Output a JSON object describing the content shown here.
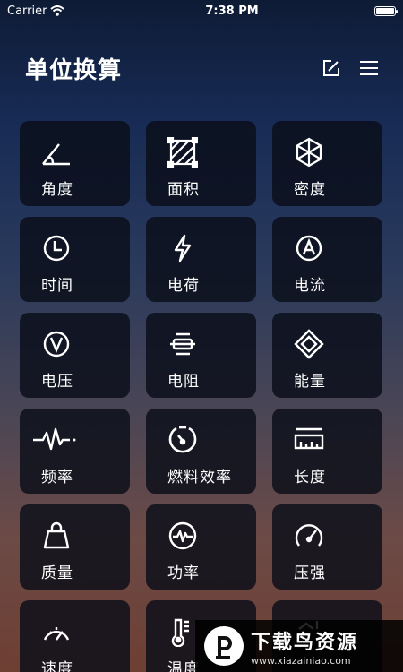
{
  "status_bar": {
    "carrier": "Carrier",
    "time": "7:38 PM",
    "battery_level": 1.0
  },
  "header": {
    "title": "单位换算",
    "edit_icon": "edit-icon",
    "menu_icon": "menu-icon"
  },
  "tiles": [
    {
      "label": "角度",
      "icon": "angle-icon"
    },
    {
      "label": "面积",
      "icon": "area-icon"
    },
    {
      "label": "密度",
      "icon": "density-icon"
    },
    {
      "label": "时间",
      "icon": "clock-icon"
    },
    {
      "label": "电荷",
      "icon": "lightning-icon"
    },
    {
      "label": "电流",
      "icon": "current-icon"
    },
    {
      "label": "电压",
      "icon": "voltage-icon"
    },
    {
      "label": "电阻",
      "icon": "resistor-icon"
    },
    {
      "label": "能量",
      "icon": "energy-icon"
    },
    {
      "label": "频率",
      "icon": "frequency-icon"
    },
    {
      "label": "燃料效率",
      "icon": "fuel-efficiency-icon"
    },
    {
      "label": "长度",
      "icon": "ruler-icon"
    },
    {
      "label": "质量",
      "icon": "weight-icon"
    },
    {
      "label": "功率",
      "icon": "power-icon"
    },
    {
      "label": "压强",
      "icon": "pressure-gauge-icon"
    },
    {
      "label": "速度",
      "icon": "speedometer-icon"
    },
    {
      "label": "温度",
      "icon": "thermometer-icon"
    },
    {
      "label": "",
      "icon": "partial-icon"
    }
  ],
  "watermark": {
    "title": "下载鸟资源",
    "url": "www.xiazainiao.com"
  }
}
